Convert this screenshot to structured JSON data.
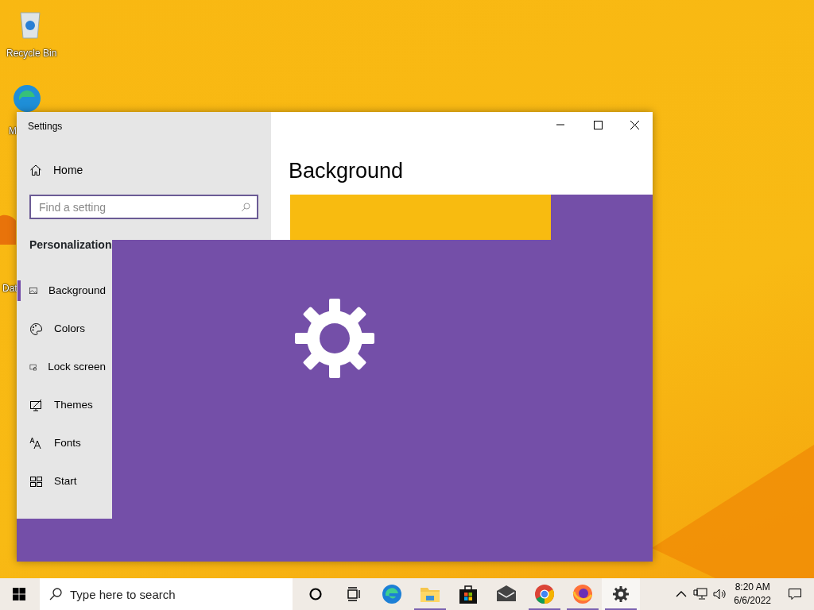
{
  "desktop_icons": [
    {
      "kind": "recycle",
      "label": "Recycle Bin"
    },
    {
      "kind": "edge",
      "label": "M"
    },
    {
      "kind": "file",
      "label": "Dat"
    }
  ],
  "window": {
    "title": "Settings",
    "controls": [
      {
        "kind": "minimize"
      },
      {
        "kind": "maximize"
      },
      {
        "kind": "close"
      }
    ]
  },
  "sidebar": {
    "home": "Home",
    "search": {
      "placeholder": "Find a setting"
    },
    "section": "Personalization",
    "items": [
      {
        "label": "Background",
        "selected": true
      },
      {
        "label": "Colors",
        "selected": false
      },
      {
        "label": "Lock screen",
        "selected": false
      },
      {
        "label": "Themes",
        "selected": false
      },
      {
        "label": "Fonts",
        "selected": false
      },
      {
        "label": "Start",
        "selected": false
      }
    ]
  },
  "content": {
    "heading": "Background"
  },
  "taskbar": {
    "search": {
      "placeholder": "Type here to search"
    },
    "apps": [
      {
        "kind": "cortana",
        "running": false,
        "active": false
      },
      {
        "kind": "taskview",
        "running": false,
        "active": false
      },
      {
        "kind": "edge",
        "running": false,
        "active": false
      },
      {
        "kind": "explorer",
        "running": true,
        "active": false
      },
      {
        "kind": "store",
        "running": false,
        "active": false
      },
      {
        "kind": "mail",
        "running": false,
        "active": false
      },
      {
        "kind": "chrome",
        "running": true,
        "active": false
      },
      {
        "kind": "firefox",
        "running": true,
        "active": false
      },
      {
        "kind": "settings",
        "running": true,
        "active": true
      }
    ],
    "tray": {
      "time": "8:20 AM",
      "date": "6/6/2022"
    }
  }
}
